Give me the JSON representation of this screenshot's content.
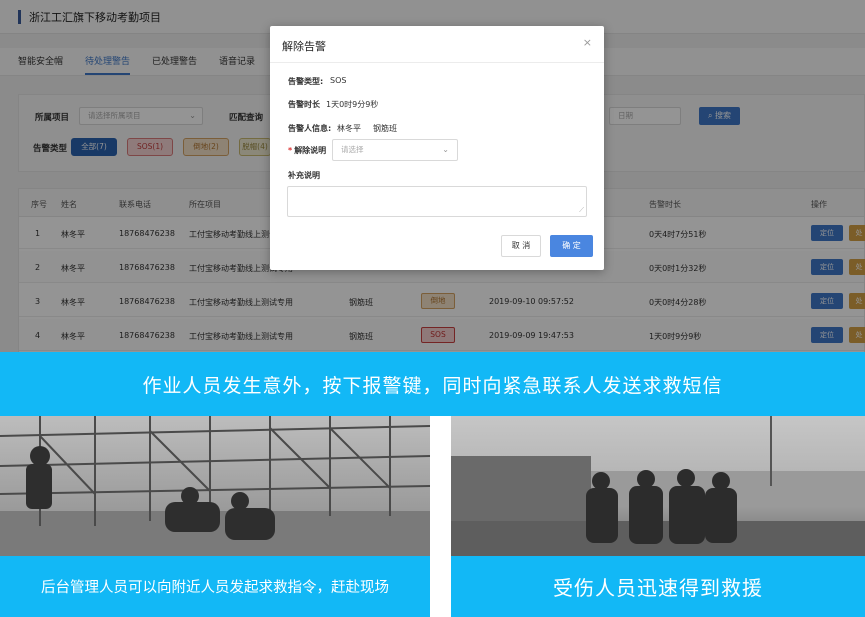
{
  "app": {
    "title": "浙江工汇旗下移动考勤项目",
    "tabs": [
      "智能安全帽",
      "待处理警告",
      "已处理警告",
      "语音记录"
    ],
    "filter": {
      "project_label": "所属项目",
      "project_placeholder": "请选择所属项目",
      "match_label": "匹配查询",
      "date_placeholder": "日期",
      "search_button": "搜索",
      "type_label": "告警类型",
      "type_buttons": [
        "全部(7)",
        "SOS(1)",
        "倒地(2)",
        "脱帽(4)"
      ]
    },
    "table": {
      "headers": [
        "序号",
        "姓名",
        "联系电话",
        "所在项目",
        "告警时长",
        "操作"
      ],
      "rows": [
        {
          "idx": "1",
          "name": "林冬平",
          "phone": "18768476238",
          "project": "工付宝移动考勤线上测试专用",
          "duration": "0天4时7分51秒",
          "badge": "",
          "time": ""
        },
        {
          "idx": "2",
          "name": "林冬平",
          "phone": "18768476238",
          "project": "工付宝移动考勤线上测试专用",
          "duration": "0天0时1分32秒",
          "badge": "",
          "time": ""
        },
        {
          "idx": "3",
          "name": "林冬平",
          "phone": "18768476238",
          "project": "工付宝移动考勤线上测试专用",
          "team": "钢筋班",
          "badge": "倒地",
          "time": "2019-09-10 09:57:52",
          "duration": "0天0时4分28秒"
        },
        {
          "idx": "4",
          "name": "林冬平",
          "phone": "18768476238",
          "project": "工付宝移动考勤线上测试专用",
          "team": "钢筋班",
          "badge": "SOS",
          "time": "2019-09-09 19:47:53",
          "duration": "1天0时9分9秒"
        }
      ],
      "locate_button": "定位",
      "handle_button": "处"
    }
  },
  "modal": {
    "title": "解除告警",
    "close_icon": "×",
    "alarm_type_label": "告警类型:",
    "alarm_type_value": "SOS",
    "alarm_duration_label": "告警时长",
    "alarm_duration_value": "1天0时9分9秒",
    "alarm_person_label": "告警人信息:",
    "alarm_person_name": "林冬平",
    "alarm_person_team": "钢筋班",
    "release_label": "解除说明",
    "release_placeholder": "请选择",
    "supplement_label": "补充说明",
    "cancel_button": "取 消",
    "ok_button": "确 定"
  },
  "banners": {
    "top": "作业人员发生意外，按下报警键，同时向紧急联系人发送求救短信",
    "bottom_left": "后台管理人员可以向附近人员发起求救指令，赶赴现场",
    "bottom_right": "受伤人员迅速得到救援"
  },
  "colors": {
    "banner": "#12b8f6",
    "primary": "#3e78c8",
    "sos": "#c03030",
    "fall": "#b27530"
  }
}
